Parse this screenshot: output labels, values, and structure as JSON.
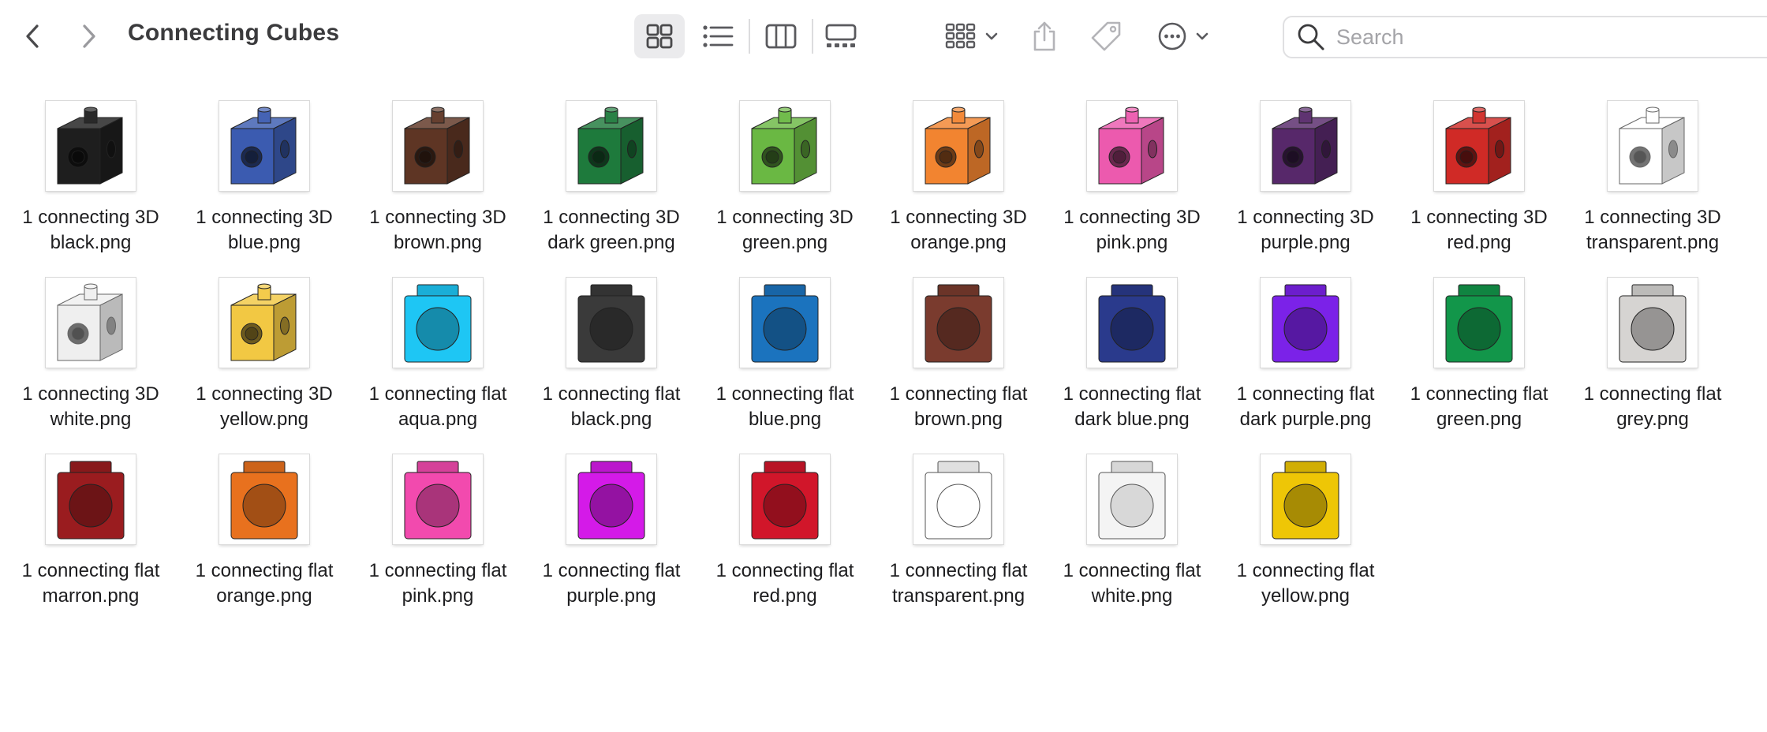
{
  "window": {
    "title": "Connecting Cubes"
  },
  "toolbar": {
    "back_icon": "chevron-left-icon",
    "forward_icon": "chevron-right-icon",
    "views": [
      "icon-view",
      "list-view",
      "column-view",
      "gallery-view"
    ],
    "active_view": "icon-view",
    "group_icon": "group-grid-icon",
    "share_icon": "share-icon",
    "tag_icon": "tag-icon",
    "more_icon": "ellipsis-circle-icon"
  },
  "search": {
    "placeholder": "Search",
    "value": ""
  },
  "files": [
    {
      "line1": "1 connecting 3D",
      "line2": "black.png",
      "kind": "3d",
      "color": "#1e1e1e"
    },
    {
      "line1": "1 connecting 3D",
      "line2": "blue.png",
      "kind": "3d",
      "color": "#3b5bb0"
    },
    {
      "line1": "1 connecting 3D",
      "line2": "brown.png",
      "kind": "3d",
      "color": "#5e3524"
    },
    {
      "line1": "1 connecting 3D",
      "line2": "dark green.png",
      "kind": "3d",
      "color": "#1e7a3c"
    },
    {
      "line1": "1 connecting 3D",
      "line2": "green.png",
      "kind": "3d",
      "color": "#6ab843"
    },
    {
      "line1": "1 connecting 3D",
      "line2": "orange.png",
      "kind": "3d",
      "color": "#f28430"
    },
    {
      "line1": "1 connecting 3D",
      "line2": "pink.png",
      "kind": "3d",
      "color": "#ec5aae"
    },
    {
      "line1": "1 connecting 3D",
      "line2": "purple.png",
      "kind": "3d",
      "color": "#57286a"
    },
    {
      "line1": "1 connecting 3D",
      "line2": "red.png",
      "kind": "3d",
      "color": "#d02a26"
    },
    {
      "line1": "1 connecting 3D",
      "line2": "transparent.png",
      "kind": "3d",
      "color": "#ffffff"
    },
    {
      "line1": "1 connecting 3D",
      "line2": "white.png",
      "kind": "3d",
      "color": "#efefef"
    },
    {
      "line1": "1 connecting 3D",
      "line2": "yellow.png",
      "kind": "3d",
      "color": "#f2c843"
    },
    {
      "line1": "1 connecting flat",
      "line2": "aqua.png",
      "kind": "flat",
      "color": "#1ec6f4"
    },
    {
      "line1": "1 connecting flat",
      "line2": "black.png",
      "kind": "flat",
      "color": "#3a3a3a"
    },
    {
      "line1": "1 connecting flat",
      "line2": "blue.png",
      "kind": "flat",
      "color": "#1b73be"
    },
    {
      "line1": "1 connecting flat",
      "line2": "brown.png",
      "kind": "flat",
      "color": "#7a3b2e"
    },
    {
      "line1": "1 connecting flat",
      "line2": "dark blue.png",
      "kind": "flat",
      "color": "#2a3a8c"
    },
    {
      "line1": "1 connecting flat",
      "line2": "dark purple.png",
      "kind": "flat",
      "color": "#7b22e8"
    },
    {
      "line1": "1 connecting flat",
      "line2": "green.png",
      "kind": "flat",
      "color": "#12964a"
    },
    {
      "line1": "1 connecting flat",
      "line2": "grey.png",
      "kind": "flat",
      "color": "#d6d4d2"
    },
    {
      "line1": "1 connecting flat",
      "line2": "marron.png",
      "kind": "flat",
      "color": "#9a1c1f"
    },
    {
      "line1": "1 connecting flat",
      "line2": "orange.png",
      "kind": "flat",
      "color": "#e8711e"
    },
    {
      "line1": "1 connecting flat",
      "line2": "pink.png",
      "kind": "flat",
      "color": "#f24aae"
    },
    {
      "line1": "1 connecting flat",
      "line2": "purple.png",
      "kind": "flat",
      "color": "#d41ae8"
    },
    {
      "line1": "1 connecting flat",
      "line2": "red.png",
      "kind": "flat",
      "color": "#d1162a"
    },
    {
      "line1": "1 connecting flat",
      "line2": "transparent.png",
      "kind": "flat",
      "color": "#ffffff"
    },
    {
      "line1": "1 connecting flat",
      "line2": "white.png",
      "kind": "flat",
      "color": "#f4f4f4"
    },
    {
      "line1": "1 connecting flat",
      "line2": "yellow.png",
      "kind": "flat",
      "color": "#eec606"
    }
  ]
}
